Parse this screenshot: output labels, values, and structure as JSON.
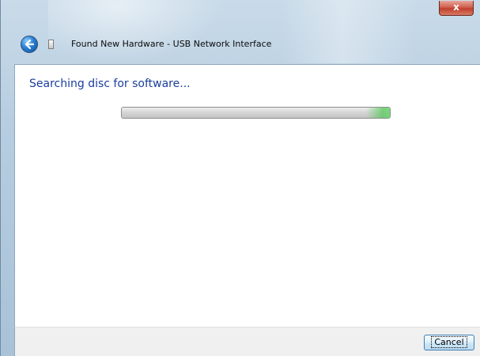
{
  "window": {
    "title": "Found New Hardware - USB Network Interface",
    "close_label": "x"
  },
  "content": {
    "heading": "Searching disc for software...",
    "progress": {
      "mode": "indeterminate",
      "accent_color": "#55c85a"
    }
  },
  "footer": {
    "cancel_label": "Cancel"
  },
  "icons": {
    "back": "back-arrow-icon",
    "device": "usb-device-icon",
    "close": "close-icon"
  },
  "colors": {
    "heading": "#1a3e9b",
    "titlebar": "#b7cde0",
    "close": "#c0402d"
  }
}
